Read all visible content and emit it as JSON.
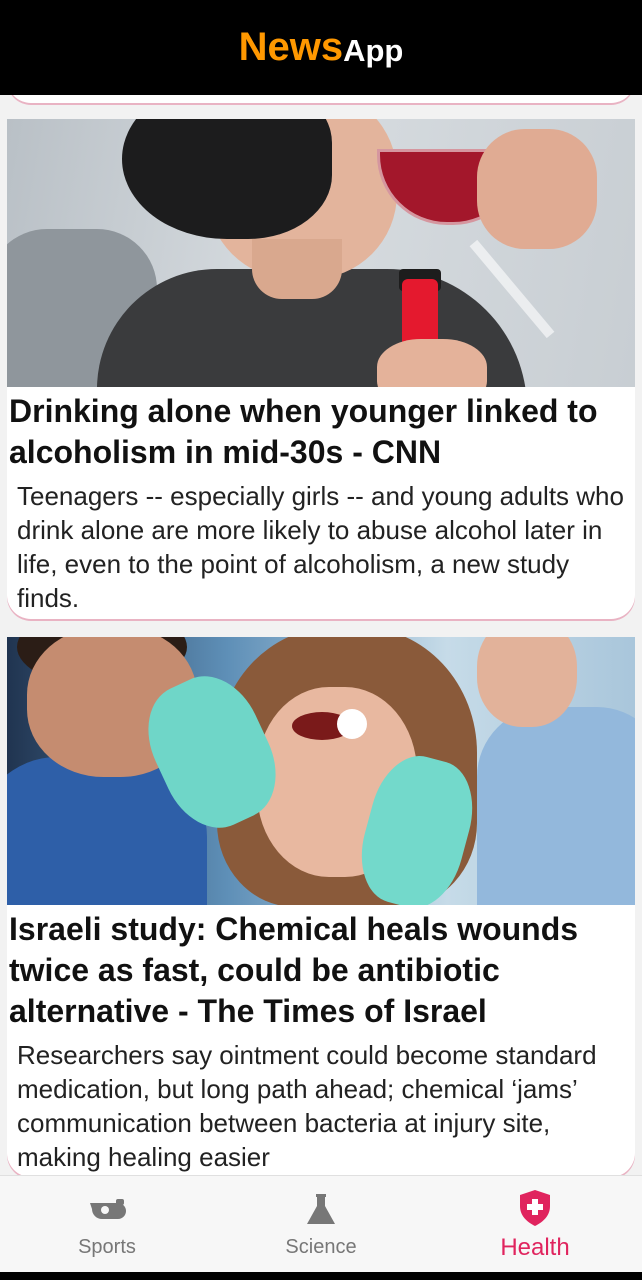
{
  "header": {
    "brand_part1": "News",
    "brand_part2": "App"
  },
  "articles": [
    {
      "title": "Drinking alone when younger linked to alcoholism in mid-30s - CNN",
      "description": "Teenagers -- especially girls -- and young adults who drink alone are more likely to abuse alcohol later in life, even to the point of alcoholism, a new study finds."
    },
    {
      "title": "Israeli study: Chemical heals wounds twice as fast, could be antibiotic alternative - The Times of Israel",
      "description": "Researchers say ointment could become standard medication, but long path ahead; chemical ‘jams’ communication between bacteria at injury site, making healing easier"
    }
  ],
  "nav": {
    "items": [
      {
        "label": "Sports",
        "icon": "whistle-icon"
      },
      {
        "label": "Science",
        "icon": "flask-icon"
      },
      {
        "label": "Health",
        "icon": "health-shield-icon"
      }
    ],
    "active": "Health",
    "active_color": "#e0245e",
    "inactive_color": "#777777"
  },
  "colors": {
    "brand_orange": "#ff9800",
    "header_bg": "#000000"
  }
}
